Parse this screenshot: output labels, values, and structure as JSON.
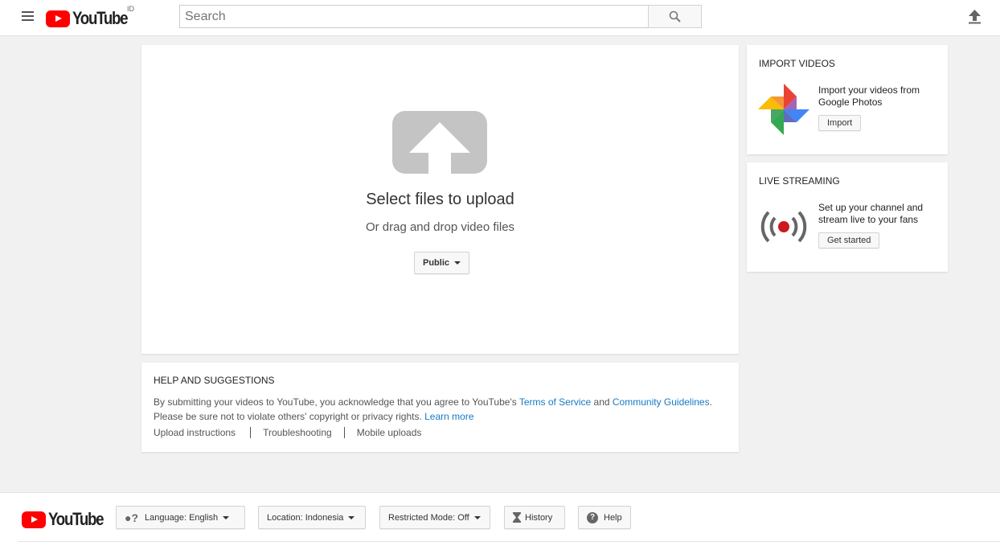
{
  "header": {
    "logo_text": "YouTube",
    "region": "ID",
    "search_placeholder": "Search"
  },
  "upload": {
    "title": "Select files to upload",
    "subtitle": "Or drag and drop video files",
    "privacy": "Public"
  },
  "help": {
    "title": "HELP AND SUGGESTIONS",
    "text1": "By submitting your videos to YouTube, you acknowledge that you agree to YouTube's ",
    "tos": "Terms of Service",
    "and": " and ",
    "guidelines": "Community Guidelines",
    "period": ".",
    "text2": "Please be sure not to violate others' copyright or privacy rights. ",
    "learn_more": "Learn more",
    "links": [
      "Upload instructions",
      "Troubleshooting",
      "Mobile uploads"
    ]
  },
  "import": {
    "title": "IMPORT VIDEOS",
    "text": "Import your videos from Google Photos",
    "button": "Import"
  },
  "live": {
    "title": "LIVE STREAMING",
    "text": "Set up your channel and stream live to your fans",
    "button": "Get started"
  },
  "footer": {
    "logo_text": "YouTube",
    "language": "Language: English",
    "location": "Location: Indonesia",
    "restricted": "Restricted Mode: Off",
    "history": "History",
    "help": "Help"
  },
  "colors": {
    "brand": "#ff0000",
    "link": "#167ac6",
    "live_dot": "#cc181e"
  }
}
